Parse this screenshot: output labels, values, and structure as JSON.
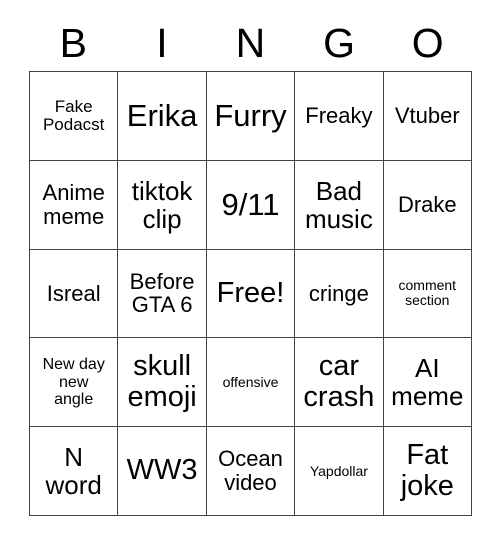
{
  "card": {
    "header_letters": [
      "B",
      "I",
      "N",
      "G",
      "O"
    ],
    "colors": {
      "background": "#ffffff",
      "text": "#000000",
      "grid_line": "#444444"
    },
    "rows": [
      [
        {
          "text": "Fake\nPodacst",
          "size": "sm"
        },
        {
          "text": "Erika",
          "size": "xxl"
        },
        {
          "text": "Furry",
          "size": "xxl"
        },
        {
          "text": "Freaky",
          "size": "m"
        },
        {
          "text": "Vtuber",
          "size": "m"
        }
      ],
      [
        {
          "text": "Anime\nmeme",
          "size": "m"
        },
        {
          "text": "tiktok\nclip",
          "size": "l"
        },
        {
          "text": "9/11",
          "size": "xxl"
        },
        {
          "text": "Bad\nmusic",
          "size": "l"
        },
        {
          "text": "Drake",
          "size": "m"
        }
      ],
      [
        {
          "text": "Isreal",
          "size": "m"
        },
        {
          "text": "Before\nGTA 6",
          "size": "m"
        },
        {
          "text": "Free!",
          "size": "xl"
        },
        {
          "text": "cringe",
          "size": "m"
        },
        {
          "text": "comment\nsection",
          "size": "xs"
        }
      ],
      [
        {
          "text": "New day\nnew\nangle",
          "size": "s"
        },
        {
          "text": "skull\nemoji",
          "size": "xl"
        },
        {
          "text": "offensive",
          "size": "xs"
        },
        {
          "text": "car\ncrash",
          "size": "xl"
        },
        {
          "text": "AI\nmeme",
          "size": "l"
        }
      ],
      [
        {
          "text": "N\nword",
          "size": "l"
        },
        {
          "text": "WW3",
          "size": "xl"
        },
        {
          "text": "Ocean\nvideo",
          "size": "m"
        },
        {
          "text": "Yapdollar",
          "size": "xs"
        },
        {
          "text": "Fat\njoke",
          "size": "xl"
        }
      ]
    ]
  }
}
